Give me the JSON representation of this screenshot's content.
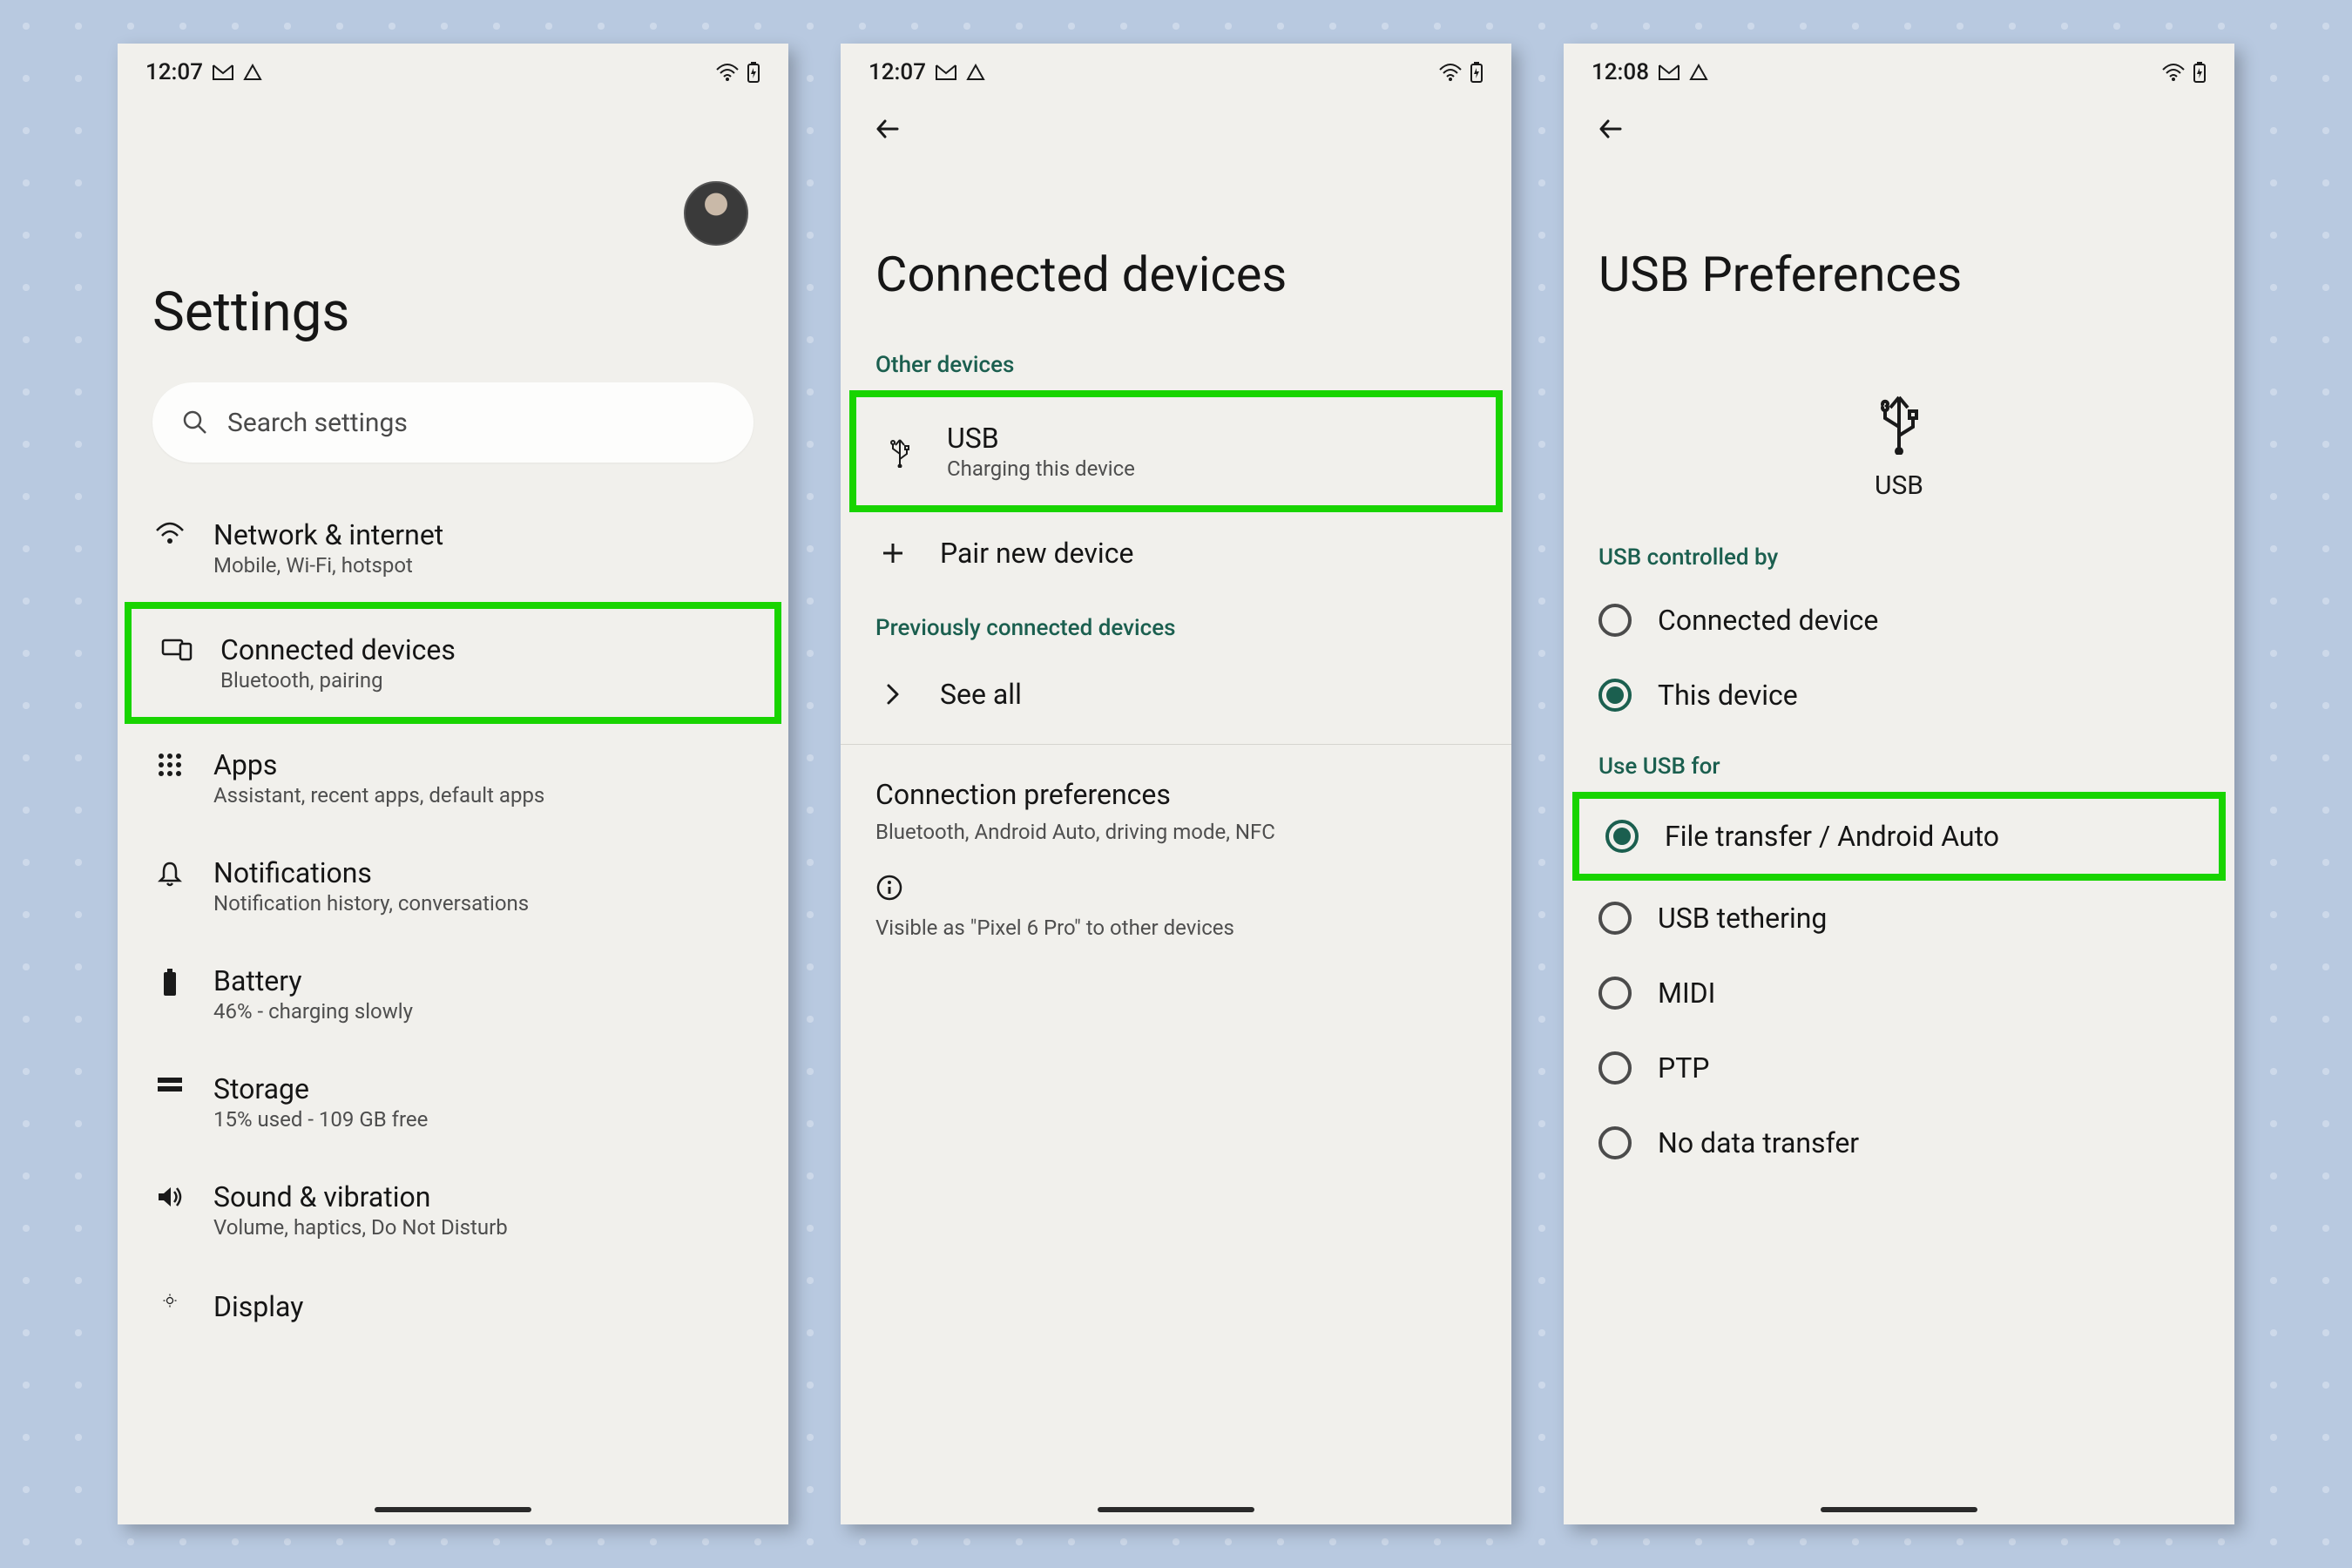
{
  "screens": [
    {
      "status": {
        "time": "12:07"
      },
      "title": "Settings",
      "search_placeholder": "Search settings",
      "items": [
        {
          "title": "Network & internet",
          "sub": "Mobile, Wi-Fi, hotspot"
        },
        {
          "title": "Connected devices",
          "sub": "Bluetooth, pairing",
          "highlighted": true
        },
        {
          "title": "Apps",
          "sub": "Assistant, recent apps, default apps"
        },
        {
          "title": "Notifications",
          "sub": "Notification history, conversations"
        },
        {
          "title": "Battery",
          "sub": "46% - charging slowly"
        },
        {
          "title": "Storage",
          "sub": "15% used - 109 GB free"
        },
        {
          "title": "Sound & vibration",
          "sub": "Volume, haptics, Do Not Disturb"
        },
        {
          "title": "Display",
          "sub": ""
        }
      ]
    },
    {
      "status": {
        "time": "12:07"
      },
      "title": "Connected devices",
      "sections": {
        "other_devices_label": "Other devices",
        "usb": {
          "title": "USB",
          "sub": "Charging this device",
          "highlighted": true
        },
        "pair_new": "Pair new device",
        "prev_label": "Previously connected devices",
        "see_all": "See all",
        "conn_pref": {
          "title": "Connection preferences",
          "sub": "Bluetooth, Android Auto, driving mode, NFC"
        },
        "footnote": "Visible as \"Pixel 6 Pro\" to other devices"
      }
    },
    {
      "status": {
        "time": "12:08"
      },
      "title": "USB Preferences",
      "usb_label": "USB",
      "controlled_by_label": "USB controlled by",
      "controlled_by_options": [
        {
          "label": "Connected device",
          "checked": false
        },
        {
          "label": "This device",
          "checked": true
        }
      ],
      "use_for_label": "Use USB for",
      "use_for_options": [
        {
          "label": "File transfer / Android Auto",
          "checked": true,
          "highlighted": true
        },
        {
          "label": "USB tethering",
          "checked": false
        },
        {
          "label": "MIDI",
          "checked": false
        },
        {
          "label": "PTP",
          "checked": false
        },
        {
          "label": "No data transfer",
          "checked": false
        }
      ]
    }
  ]
}
